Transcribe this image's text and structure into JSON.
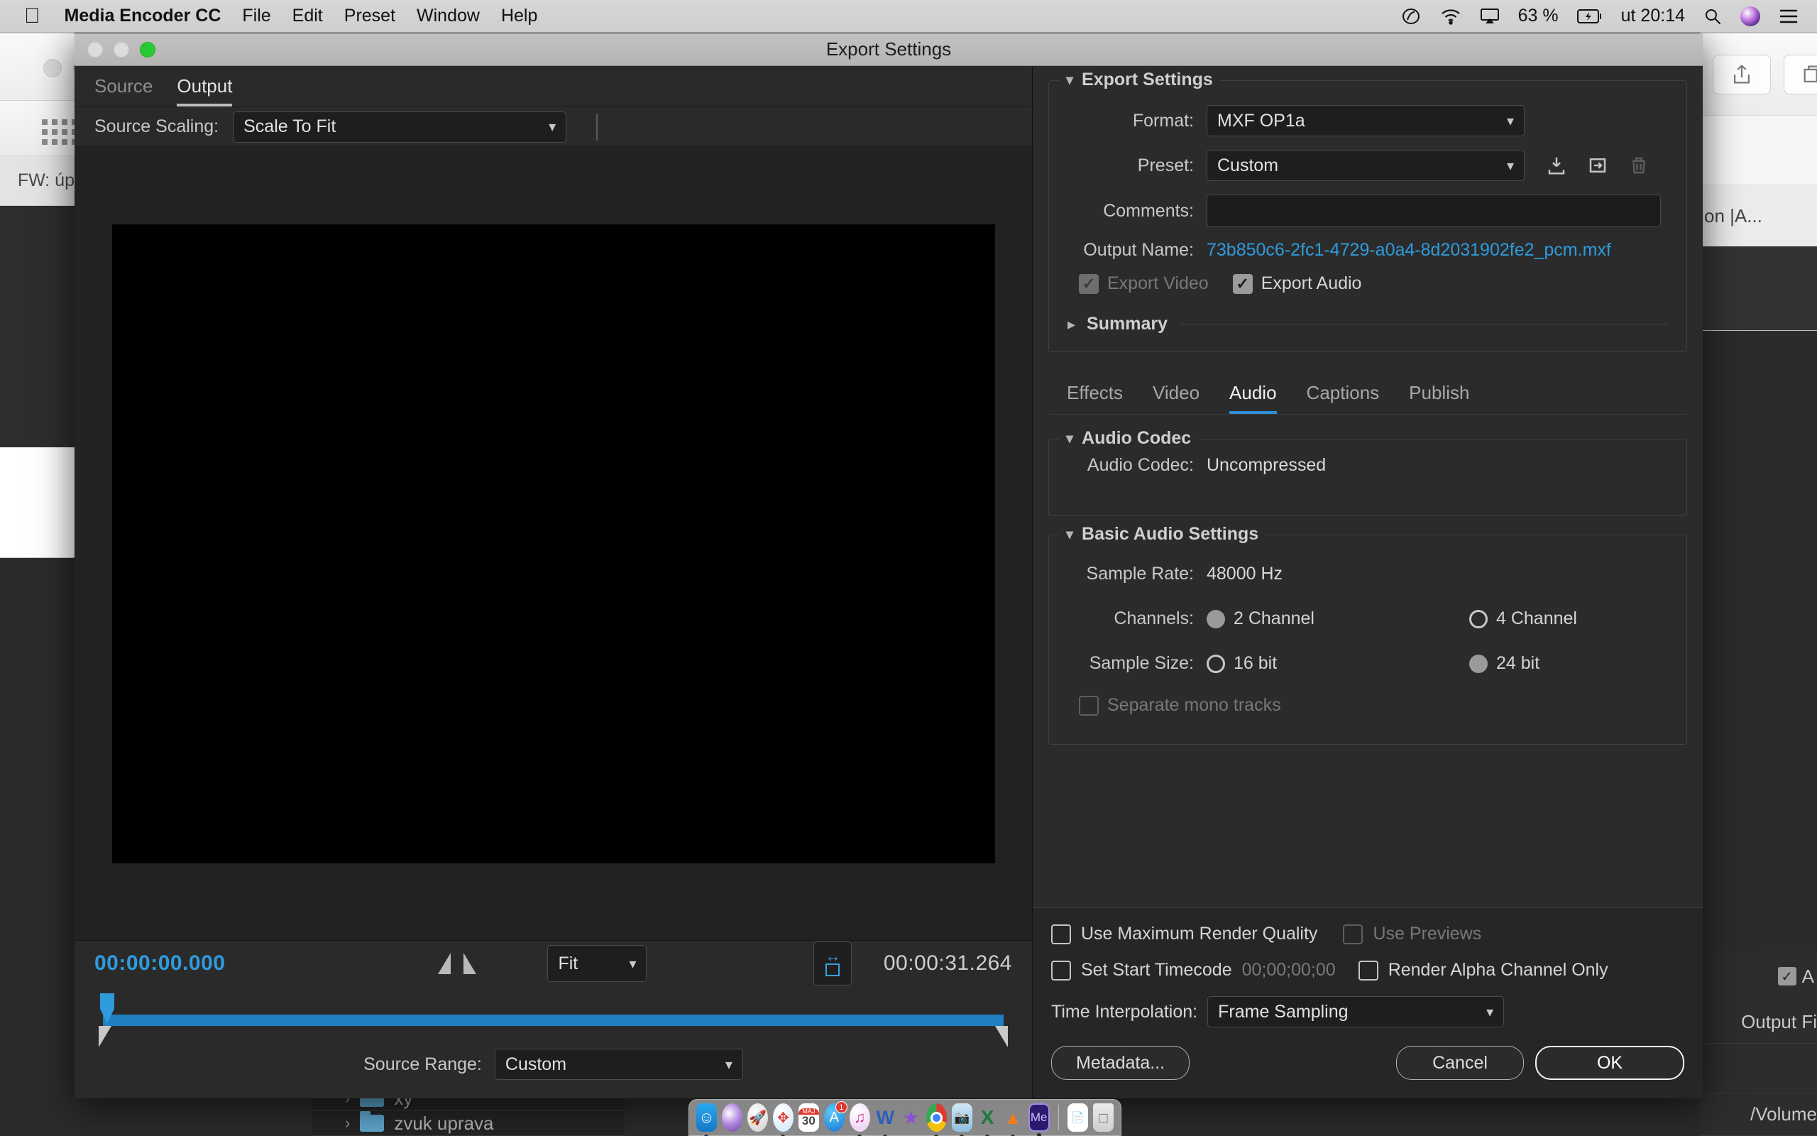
{
  "menubar": {
    "apple": "apple-logo",
    "app": "Media Encoder CC",
    "items": [
      "File",
      "Edit",
      "Preset",
      "Window",
      "Help"
    ],
    "battery_pct": "63 %",
    "clock": "ut 20:14",
    "icons": [
      "creative-cloud-icon",
      "wifi-icon",
      "airplay-icon",
      "battery-icon",
      "search-icon",
      "siri-icon",
      "notification-center-icon"
    ]
  },
  "background": {
    "left_window_tab": "FW: úp",
    "right_window_tab": "on |A...",
    "right_window_plus": "+",
    "right_panel": {
      "output_file_label": "Output Fi",
      "path": "/Volume"
    },
    "tree": [
      {
        "name": "xy"
      },
      {
        "name": "zvuk uprava"
      }
    ]
  },
  "dialog": {
    "title": "Export Settings",
    "left": {
      "tabs": [
        {
          "label": "Source",
          "active": false
        },
        {
          "label": "Output",
          "active": true
        }
      ],
      "source_scaling_label": "Source Scaling:",
      "source_scaling_value": "Scale To Fit",
      "player": {
        "time_in": "00:00:00.000",
        "time_out": "00:00:31.264",
        "zoom_value": "Fit",
        "source_range_label": "Source Range:",
        "source_range_value": "Custom"
      }
    },
    "export_settings": {
      "group_title": "Export Settings",
      "format_label": "Format:",
      "format_value": "MXF OP1a",
      "preset_label": "Preset:",
      "preset_value": "Custom",
      "comments_label": "Comments:",
      "comments_value": "",
      "output_name_label": "Output Name:",
      "output_name_value": "73b850c6-2fc1-4729-a0a4-8d2031902fe2_pcm.mxf",
      "export_video_label": "Export Video",
      "export_video_checked": true,
      "export_video_enabled": false,
      "export_audio_label": "Export Audio",
      "export_audio_checked": true,
      "summary_label": "Summary",
      "preset_buttons": [
        "save-preset-icon",
        "import-preset-icon",
        "delete-preset-icon"
      ]
    },
    "tabs": [
      {
        "label": "Effects",
        "active": false
      },
      {
        "label": "Video",
        "active": false
      },
      {
        "label": "Audio",
        "active": true
      },
      {
        "label": "Captions",
        "active": false
      },
      {
        "label": "Publish",
        "active": false
      }
    ],
    "audio_codec": {
      "group_title": "Audio Codec",
      "codec_label": "Audio Codec:",
      "codec_value": "Uncompressed"
    },
    "basic_audio": {
      "group_title": "Basic Audio Settings",
      "sample_rate_label": "Sample Rate:",
      "sample_rate_value": "48000 Hz",
      "channels_label": "Channels:",
      "channels_options": [
        {
          "label": "2 Channel",
          "selected": true
        },
        {
          "label": "4 Channel",
          "selected": false
        }
      ],
      "sample_size_label": "Sample Size:",
      "sample_size_options": [
        {
          "label": "16 bit",
          "selected": false
        },
        {
          "label": "24 bit",
          "selected": true
        }
      ],
      "separate_mono_label": "Separate mono tracks",
      "separate_mono_checked": false
    },
    "bottom": {
      "max_render_label": "Use Maximum Render Quality",
      "max_render_checked": false,
      "use_previews_label": "Use Previews",
      "use_previews_checked": false,
      "set_start_tc_label": "Set Start Timecode",
      "set_start_tc_checked": false,
      "start_tc_value": "00;00;00;00",
      "render_alpha_label": "Render Alpha Channel Only",
      "render_alpha_checked": false,
      "time_interp_label": "Time Interpolation:",
      "time_interp_value": "Frame Sampling"
    },
    "buttons": {
      "metadata": "Metadata...",
      "cancel": "Cancel",
      "ok": "OK"
    }
  },
  "colors": {
    "accent_blue": "#2e9bdc",
    "link_blue": "#2e9bdc",
    "panel_bg": "#2b2b2b",
    "dialog_bg": "#222222"
  }
}
